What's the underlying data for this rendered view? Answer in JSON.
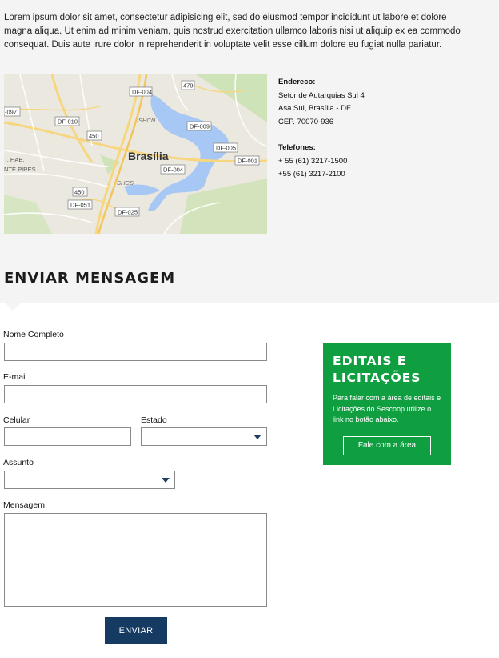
{
  "intro": {
    "text": "Lorem ipsum dolor sit amet, consectetur adipisicing elit, sed do eiusmod tempor incididunt ut labore et dolore magna aliqua. Ut enim ad minim veniam, quis nostrud exercitation ullamco laboris nisi ut aliquip ex ea commodo consequat. Duis aute irure dolor in reprehenderit in voluptate velit esse cillum dolore eu fugiat nulla pariatur."
  },
  "map": {
    "city": "Brasília",
    "labels": [
      "DF-004",
      "479",
      "SHCN",
      "DF-009",
      "DF-010",
      "-097",
      "450",
      "DF-005",
      "DF-001",
      "DF-004",
      "T. HAB.",
      "NTE PIRES",
      "SHCS",
      "450",
      "DF-051",
      "DF-025"
    ]
  },
  "contact": {
    "address_label": "Endereco:",
    "address_line1": "Setor de Autarquias Sul 4",
    "address_line2": "Asa Sul, Brasília - DF",
    "address_line3": "CEP. 70070-936",
    "phones_label": "Telefones:",
    "phone1": "+ 55 (61) 3217-1500",
    "phone2": "+55 (61) 3217-2100"
  },
  "form": {
    "title": "ENVIAR MENSAGEM",
    "name_label": "Nome Completo",
    "email_label": "E-mail",
    "phone_label": "Celular",
    "state_label": "Estado",
    "subject_label": "Assunto",
    "message_label": "Mensagem",
    "submit_label": "ENVIAR"
  },
  "promo": {
    "title_line1": "EDITAIS E",
    "title_line2": "LICITAÇÕES",
    "text": "Para falar com a área de editais e Licitações do Sescoop utilize o link no botão abaixo.",
    "button_label": "Fale com a área",
    "color": "#0f9f41"
  },
  "colors": {
    "accent": "#163b63",
    "background_band": "#f4f4f4"
  }
}
